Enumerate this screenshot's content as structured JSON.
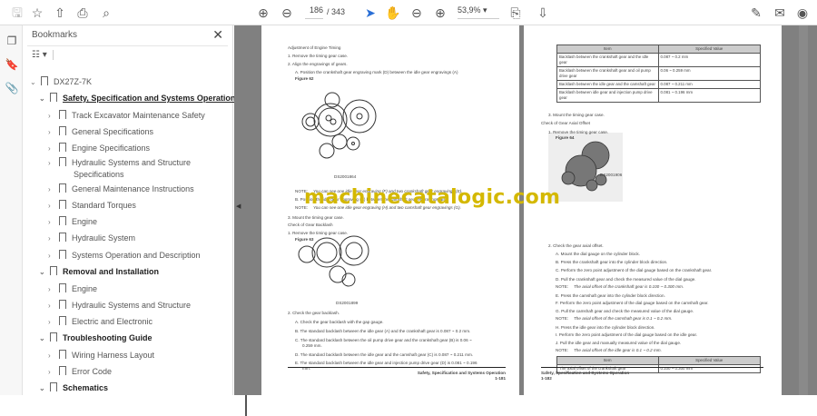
{
  "toolbar": {
    "page_current": "186",
    "page_total": "/ 343",
    "zoom": "53,9%"
  },
  "bookmarks": {
    "title": "Bookmarks",
    "items": [
      {
        "label": "DX27Z-7K",
        "level": 0
      },
      {
        "label": "Safety, Specification and Systems Operation",
        "level": 1,
        "bold": true,
        "underline": true
      },
      {
        "label": "Track Excavator Maintenance Safety",
        "level": 2
      },
      {
        "label": "General Specifications",
        "level": 2
      },
      {
        "label": "Engine Specifications",
        "level": 2
      },
      {
        "label": "Hydraulic Systems and Structure",
        "label2": "Specifications",
        "level": 2
      },
      {
        "label": "General Maintenance Instructions",
        "level": 2
      },
      {
        "label": "Standard Torques",
        "level": 2
      },
      {
        "label": "Engine",
        "level": 2
      },
      {
        "label": "Hydraulic System",
        "level": 2
      },
      {
        "label": "Systems Operation and Description",
        "level": 2
      },
      {
        "label": "Removal and Installation",
        "level": 1,
        "bold": true
      },
      {
        "label": "Engine",
        "level": 2
      },
      {
        "label": "Hydraulic Systems and Structure",
        "level": 2
      },
      {
        "label": "Electric and Electronic",
        "level": 2
      },
      {
        "label": "Troubleshooting Guide",
        "level": 1,
        "bold": true
      },
      {
        "label": "Wiring Harness Layout",
        "level": 2
      },
      {
        "label": "Error Code",
        "level": 2
      },
      {
        "label": "Schematics",
        "level": 1,
        "bold": true
      }
    ]
  },
  "left_page": {
    "lines": [
      "Adjustment of Engine Timing",
      "1.  Remove the timing gear case.",
      "2.  Align the engravings of gears.",
      "A.  Position the crankshaft gear engraving mark (D) between the idle gear engravings (A)",
      "Figure 62",
      "DS2001864",
      "NOTE:",
      "You can see one idle gear engraving (F) and two crankshaft gear engravings (E).",
      "B.  Position the idle gear engraving (A) between the camshaft gear engravings (B).",
      "NOTE:",
      "You can see one idle gear engraving (H) and two camshaft gear engravings (G).",
      "3.  Mount the timing gear case.",
      "Check of Gear Backlash",
      "1.  Remove the timing gear case.",
      "Figure 63",
      "DS2001899",
      "2.  Check the gear backlash.",
      "A.  Check the gear backlash with the gap gauge.",
      "B.  The standard backlash between the idle gear (A) and the crankshaft gear is 0.087 ~ 0.2 mm.",
      "C.  The standard backlash between the oil pump drive gear and the crankshaft gear (B) is 0.06 ~",
      "0.259 mm.",
      "D.  The standard backlash between the idle gear and the camshaft gear (C) is 0.087 ~ 0.211 mm.",
      "E.  The standard backlash between the idle gear and injection pump drive gear (D) is 0.081 ~ 0.196",
      "mm."
    ],
    "footer_title": "Safety, Specification and Systems Operation",
    "footer_page": "1-181"
  },
  "right_page": {
    "table1": {
      "headers": [
        "Item",
        "Specified Value"
      ],
      "rows": [
        [
          "Backlash between the crankshaft gear and the idle gear",
          "0.087 ~ 0.2 mm"
        ],
        [
          "Backlash between the crankshaft gear and oil pump drive gear",
          "0.06 ~ 0.259 mm"
        ],
        [
          "Backlash between the idle gear and the camshaft gear",
          "0.087 ~ 0.211 mm"
        ],
        [
          "Backlash between idle gear and injection pump drive gear",
          "0.081 ~ 0.196 mm"
        ]
      ]
    },
    "lines": [
      "3.  Mount the timing gear case.",
      "Check of Gear Axial Offset",
      "1.  Remove the timing gear case.",
      "Figure 64",
      "DS2001906",
      "2.  Check the gear axial offset.",
      "A.  Mount the dial gauge on the cylinder block.",
      "B.  Press the crankshaft gear into the cylinder block direction.",
      "C.  Perform the zero point adjustment of the dial gauge based on the crankshaft gear.",
      "D.  Pull the crankshaft gear and check the measured value of the dial gauge.",
      "NOTE:",
      "The axial offset of the crankshaft gear is 0.100 ~ 0.300 mm.",
      "E.  Press the camshaft gear into the cylinder block direction.",
      "F.  Perform the zero point adjustment of the dial gauge based on the camshaft gear.",
      "G.  Pull the camshaft gear and check the measured value of the dial gauge.",
      "NOTE:",
      "The axial offset of the camshaft gear is 0.1 ~ 0.2 mm.",
      "H.  Press the idle gear into the cylinder block direction.",
      "I.  Perform the zero point adjustment of the dial gauge based on the idle gear.",
      "J.  Pull the idle gear and manually measured value of the dial gauge.",
      "NOTE:",
      "The axial offset of the idle gear is 0.1 ~ 0.2 mm."
    ],
    "table2": {
      "headers": [
        "Item",
        "Specified Value"
      ],
      "rows": [
        [
          "The axial offset of the crankshaft gear",
          "0.100 ~ 0.300 mm"
        ]
      ]
    },
    "footer_title": "Safety, Specification and Systems Operation",
    "footer_page": "1-182"
  },
  "watermark": "machinecatalogic.com"
}
